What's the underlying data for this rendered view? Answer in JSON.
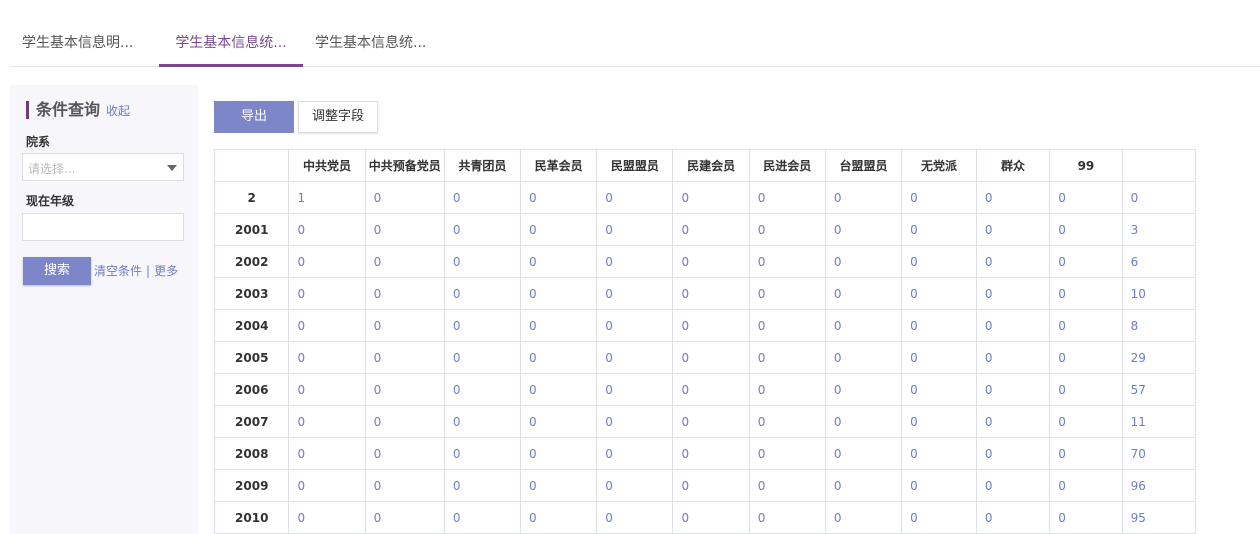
{
  "tabs": [
    {
      "label": "学生基本信息明...",
      "active": false
    },
    {
      "label": "学生基本信息统...",
      "active": true
    },
    {
      "label": "学生基本信息统...",
      "active": false
    }
  ],
  "sidebar": {
    "title": "条件查询",
    "collapse_label": "收起",
    "department_label": "院系",
    "department_placeholder": "请选择...",
    "grade_label": "现在年级",
    "grade_value": "",
    "search_label": "搜索",
    "clear_label": "清空条件",
    "separator": "|",
    "more_label": "更多"
  },
  "toolbar": {
    "export_label": "导出",
    "adjust_label": "调整字段"
  },
  "table": {
    "columns": [
      "",
      "中共党员",
      "中共预备党员",
      "共青团员",
      "民革会员",
      "民盟盟员",
      "民建会员",
      "民进会员",
      "台盟盟员",
      "无党派",
      "群众",
      "99",
      ""
    ],
    "rows": [
      {
        "label": "2",
        "cells": [
          "1",
          "0",
          "0",
          "0",
          "0",
          "0",
          "0",
          "0",
          "0",
          "0",
          "0",
          "0"
        ]
      },
      {
        "label": "2001",
        "cells": [
          "0",
          "0",
          "0",
          "0",
          "0",
          "0",
          "0",
          "0",
          "0",
          "0",
          "0",
          "3"
        ]
      },
      {
        "label": "2002",
        "cells": [
          "0",
          "0",
          "0",
          "0",
          "0",
          "0",
          "0",
          "0",
          "0",
          "0",
          "0",
          "6"
        ]
      },
      {
        "label": "2003",
        "cells": [
          "0",
          "0",
          "0",
          "0",
          "0",
          "0",
          "0",
          "0",
          "0",
          "0",
          "0",
          "10"
        ]
      },
      {
        "label": "2004",
        "cells": [
          "0",
          "0",
          "0",
          "0",
          "0",
          "0",
          "0",
          "0",
          "0",
          "0",
          "0",
          "8"
        ]
      },
      {
        "label": "2005",
        "cells": [
          "0",
          "0",
          "0",
          "0",
          "0",
          "0",
          "0",
          "0",
          "0",
          "0",
          "0",
          "29"
        ]
      },
      {
        "label": "2006",
        "cells": [
          "0",
          "0",
          "0",
          "0",
          "0",
          "0",
          "0",
          "0",
          "0",
          "0",
          "0",
          "57"
        ]
      },
      {
        "label": "2007",
        "cells": [
          "0",
          "0",
          "0",
          "0",
          "0",
          "0",
          "0",
          "0",
          "0",
          "0",
          "0",
          "11"
        ]
      },
      {
        "label": "2008",
        "cells": [
          "0",
          "0",
          "0",
          "0",
          "0",
          "0",
          "0",
          "0",
          "0",
          "0",
          "0",
          "70"
        ]
      },
      {
        "label": "2009",
        "cells": [
          "0",
          "0",
          "0",
          "0",
          "0",
          "0",
          "0",
          "0",
          "0",
          "0",
          "0",
          "96"
        ]
      },
      {
        "label": "2010",
        "cells": [
          "0",
          "0",
          "0",
          "0",
          "0",
          "0",
          "0",
          "0",
          "0",
          "0",
          "0",
          "95"
        ]
      }
    ]
  },
  "colors": {
    "accent": "#7b4a8c",
    "button": "#7d86c8",
    "link": "#6b7fc4"
  }
}
